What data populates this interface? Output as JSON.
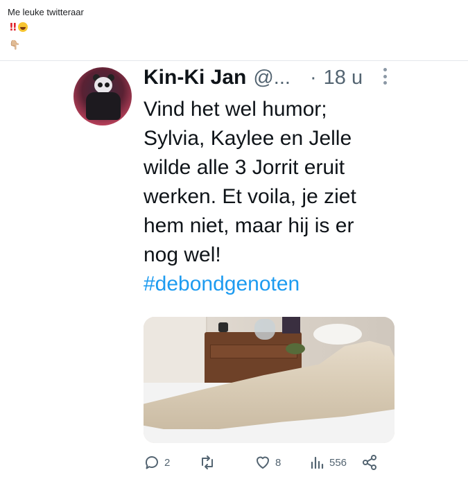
{
  "post": {
    "text": "Me leuke twitteraar",
    "emojis": [
      "double-exclamation-mark",
      "laughing-face"
    ],
    "pointer_emoji": "👇🏼"
  },
  "tweet": {
    "author_name": "Kin-Ki Jan",
    "handle": "@...",
    "separator": "·",
    "time": "18 u",
    "lines": [
      "Vind het wel humor;",
      "Sylvia, Kaylee en Jelle",
      "wilde alle 3 Jorrit eruit",
      "werken. Et voila, je ziet",
      "hem niet, maar hij is er",
      "nog wel!"
    ],
    "hashtag": "#debondgenoten",
    "stats": {
      "replies": "2",
      "retweets": "",
      "likes": "8",
      "views": "556"
    }
  },
  "colors": {
    "link": "#1d9bf0",
    "muted": "#536471",
    "text": "#0f1419"
  }
}
